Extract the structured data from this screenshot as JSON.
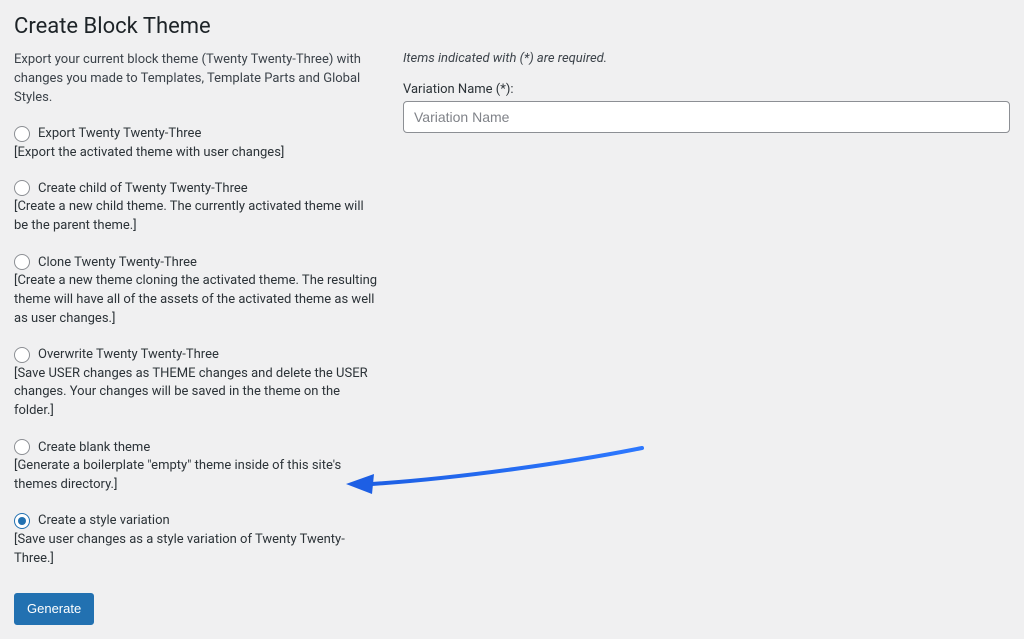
{
  "heading": "Create Block Theme",
  "intro": "Export your current block theme (Twenty Twenty-Three) with changes you made to Templates, Template Parts and Global Styles.",
  "options": {
    "export": {
      "label": "Export Twenty Twenty-Three",
      "desc": "[Export the activated theme with user changes]"
    },
    "child": {
      "label": "Create child of Twenty Twenty-Three",
      "desc": "[Create a new child theme. The currently activated theme will be the parent theme.]"
    },
    "clone": {
      "label": "Clone Twenty Twenty-Three",
      "desc": "[Create a new theme cloning the activated theme. The resulting theme will have all of the assets of the activated theme as well as user changes.]"
    },
    "overwrite": {
      "label": "Overwrite Twenty Twenty-Three",
      "desc": "[Save USER changes as THEME changes and delete the USER changes. Your changes will be saved in the theme on the folder.]"
    },
    "blank": {
      "label": "Create blank theme",
      "desc": "[Generate a boilerplate \"empty\" theme inside of this site's themes directory.]"
    },
    "variation": {
      "label": "Create a style variation",
      "desc": "[Save user changes as a style variation of Twenty Twenty-Three.]"
    }
  },
  "right": {
    "required_note": "Items indicated with (*) are required.",
    "variation_label": "Variation Name (*):",
    "variation_placeholder": "Variation Name"
  },
  "generate_label": "Generate"
}
